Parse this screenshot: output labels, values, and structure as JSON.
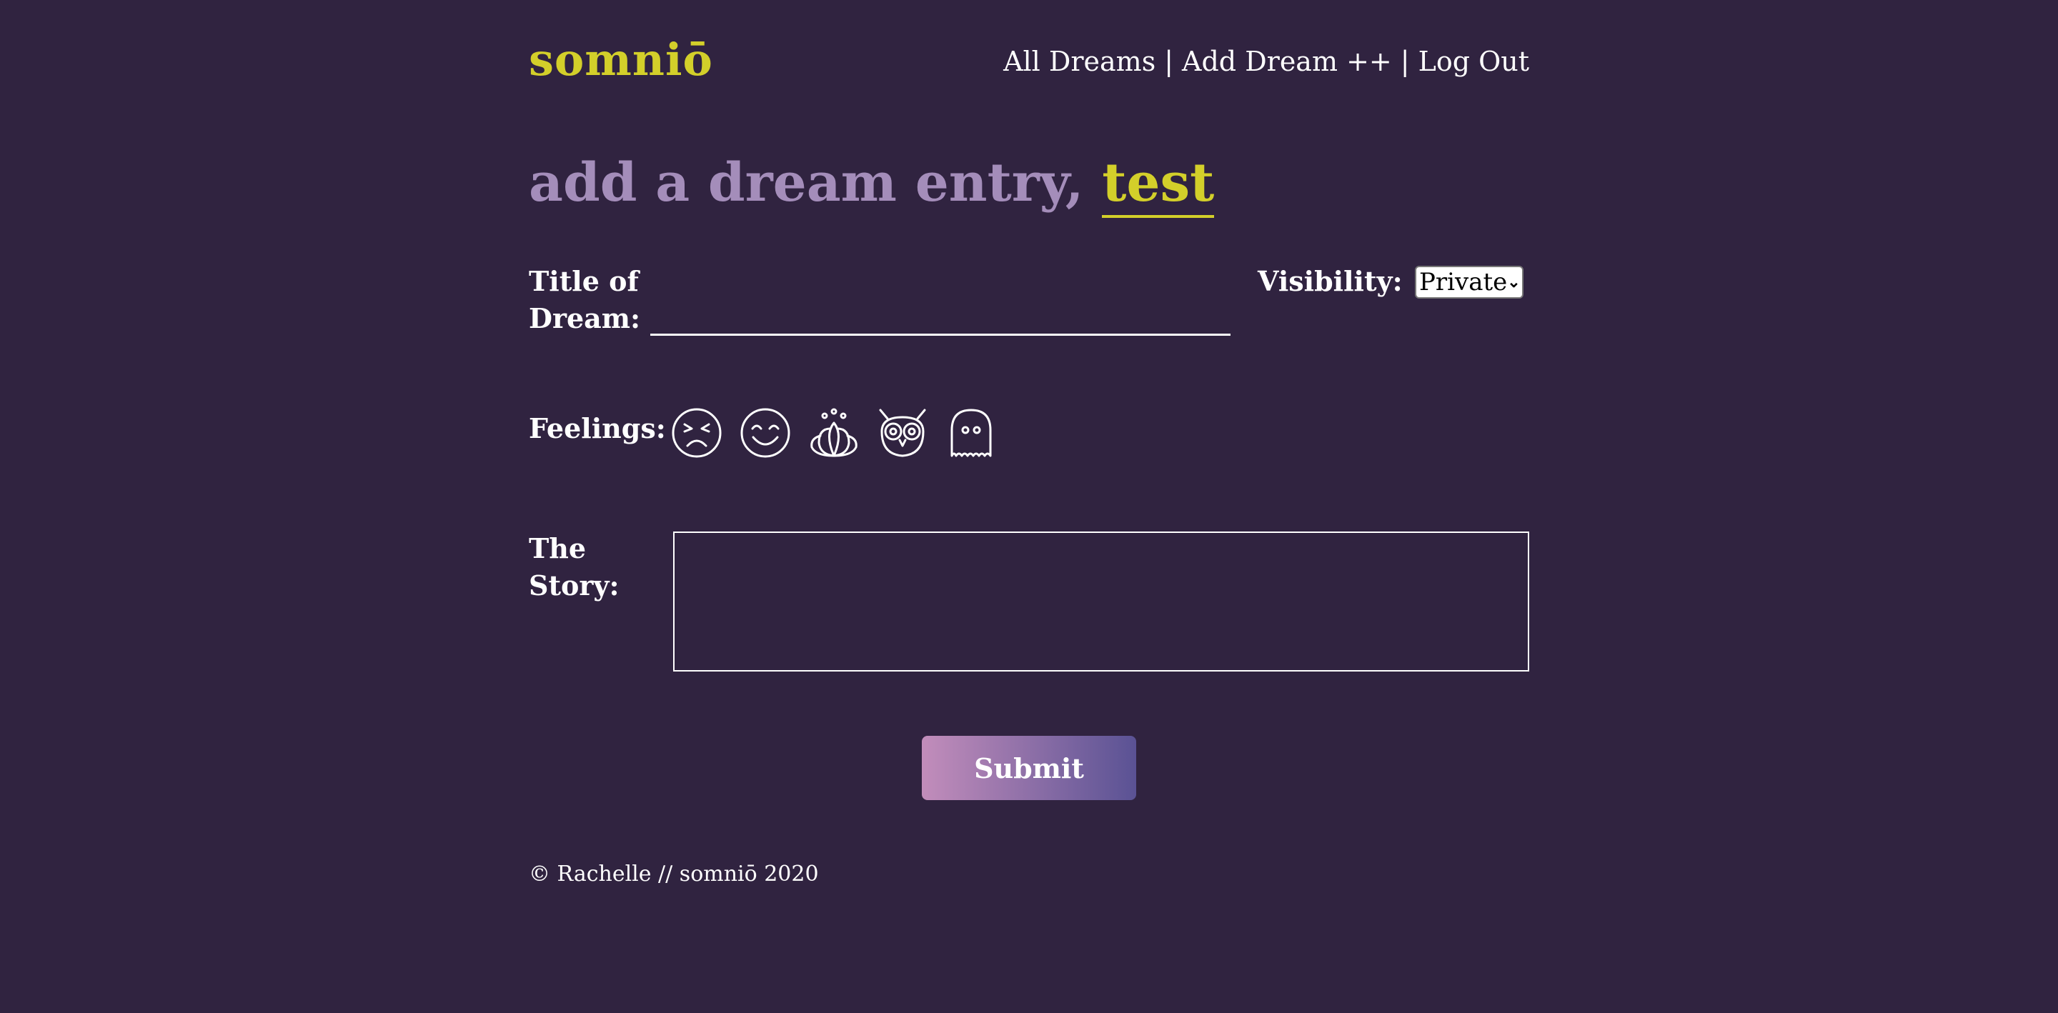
{
  "header": {
    "logo": "somniō",
    "nav": {
      "all_dreams": "All Dreams",
      "separator": "|",
      "add_dream": "Add Dream ++",
      "log_out": "Log Out"
    }
  },
  "main": {
    "heading_prefix": "add a dream entry,",
    "username": "test",
    "title_label_line1": "Title of",
    "title_label_line2": "Dream:",
    "title_value": "",
    "visibility_label": "Visibility:",
    "visibility_selected": "Private",
    "feelings_label": "Feelings:",
    "feelings_icons": [
      "angry-face-icon",
      "smiling-face-icon",
      "lotus-icon",
      "owl-icon",
      "ghost-icon"
    ],
    "story_label_line1": "The",
    "story_label_line2": "Story:",
    "story_value": "",
    "submit_label": "Submit"
  },
  "footer": {
    "text": "© Rachelle // somniō 2020"
  },
  "colors": {
    "background": "#302340",
    "accent": "#d3cf2a",
    "heading": "#a48dba",
    "button_gradient_start": "#c28dbb",
    "button_gradient_end": "#5a5294"
  }
}
